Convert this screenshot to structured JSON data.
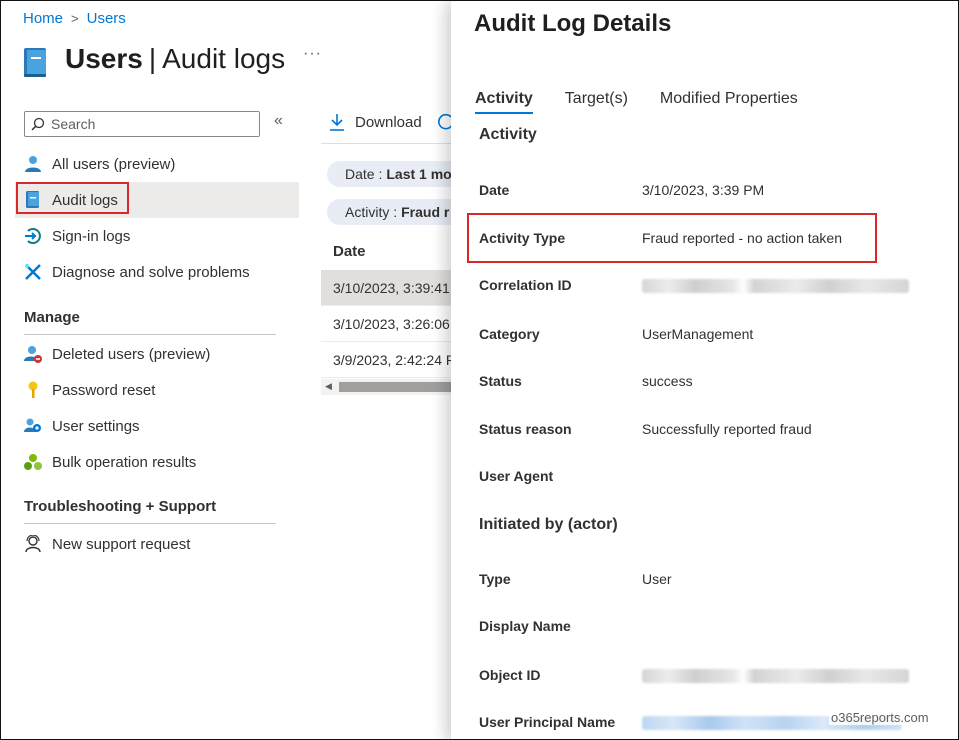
{
  "breadcrumb": {
    "home": "Home",
    "sep": ">",
    "users": "Users"
  },
  "page": {
    "title_bold": "Users",
    "pipe": "|",
    "title_rest": "Audit logs",
    "more": "···"
  },
  "search": {
    "placeholder": "Search",
    "collapse": "«"
  },
  "nav": {
    "all_users": "All users (preview)",
    "audit_logs": "Audit logs",
    "sign_in_logs": "Sign-in logs",
    "diagnose": "Diagnose and solve problems",
    "manage_heading": "Manage",
    "deleted_users": "Deleted users (preview)",
    "password_reset": "Password reset",
    "user_settings": "User settings",
    "bulk_results": "Bulk operation results",
    "troubleshoot_heading": "Troubleshooting + Support",
    "new_support": "New support request"
  },
  "toolbar": {
    "download": "Download"
  },
  "filters": [
    {
      "label": "Date :",
      "value": "Last 1 mo"
    },
    {
      "label": "Activity :",
      "value": "Fraud r"
    }
  ],
  "list": {
    "column": "Date",
    "rows": [
      "3/10/2023, 3:39:41",
      "3/10/2023, 3:26:06",
      "3/9/2023, 2:42:24 P"
    ]
  },
  "details": {
    "title": "Audit Log Details",
    "tabs": [
      "Activity",
      "Target(s)",
      "Modified Properties"
    ],
    "activity_section": "Activity",
    "fields": {
      "date_label": "Date",
      "date_value": "3/10/2023, 3:39 PM",
      "type_label": "Activity Type",
      "type_value": "Fraud reported - no action taken",
      "corr_label": "Correlation ID",
      "cat_label": "Category",
      "cat_value": "UserManagement",
      "status_label": "Status",
      "status_value": "success",
      "reason_label": "Status reason",
      "reason_value": "Successfully reported fraud",
      "agent_label": "User Agent"
    },
    "actor_section": "Initiated by (actor)",
    "actor": {
      "type_label": "Type",
      "type_value": "User",
      "display_label": "Display Name",
      "object_label": "Object ID",
      "upn_label": "User Principal Name"
    }
  },
  "watermark": "o365reports.com",
  "colors": {
    "accent": "#0078d4",
    "highlight": "#d62828"
  }
}
